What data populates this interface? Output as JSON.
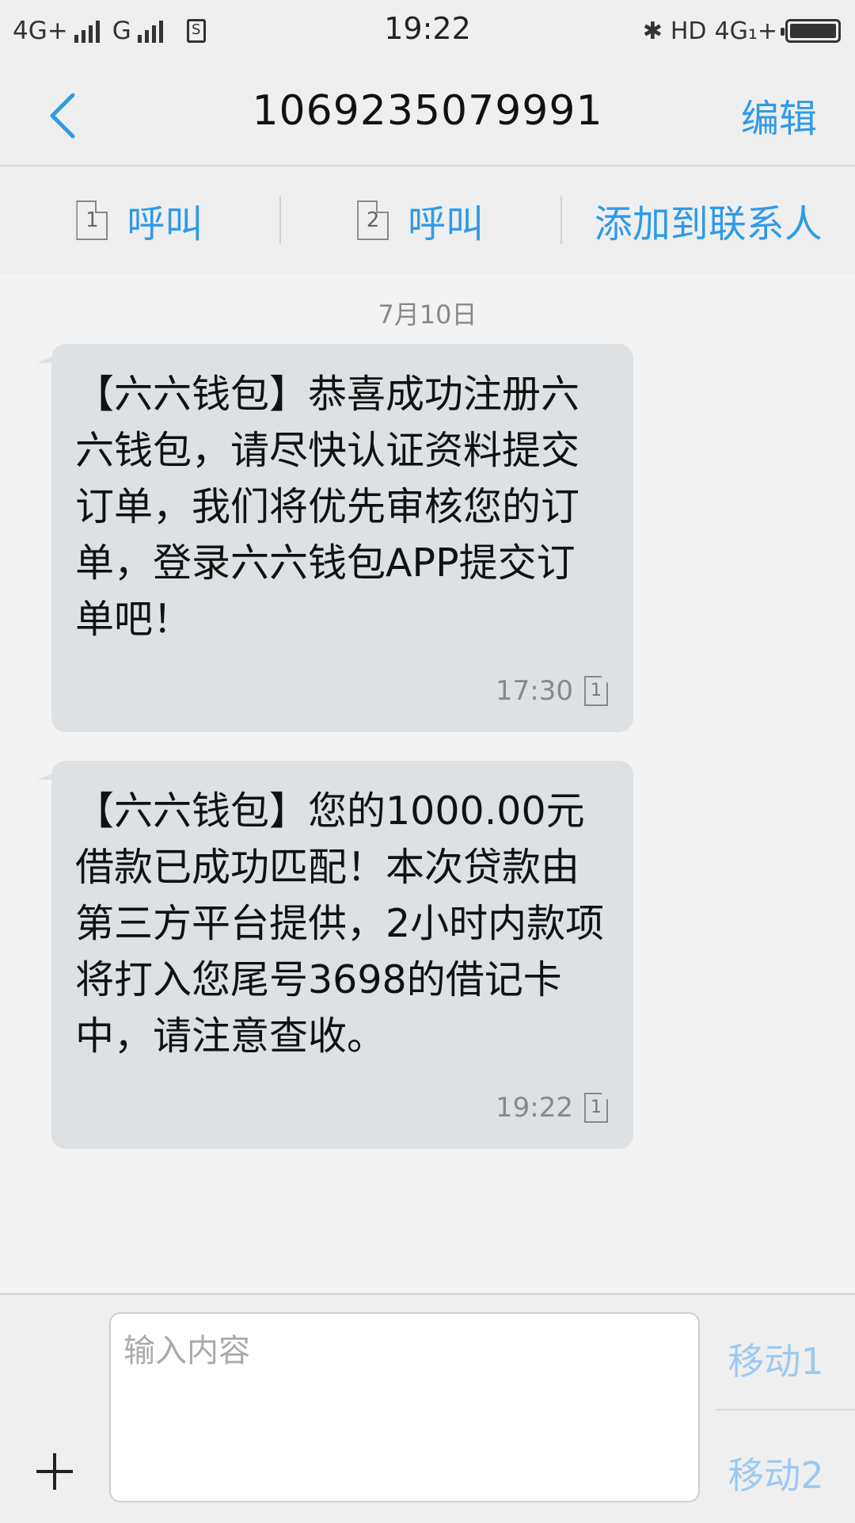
{
  "status_bar": {
    "network1": "4G+",
    "network2": "G",
    "sim_badge": "S",
    "time": "19:22",
    "hd": "HD",
    "network_right": "4G₁+"
  },
  "header": {
    "title": "1069235079991",
    "edit_label": "编辑"
  },
  "actions": {
    "call1_sim": "1",
    "call1_label": "呼叫",
    "call2_sim": "2",
    "call2_label": "呼叫",
    "add_contact_label": "添加到联系人"
  },
  "conversation": {
    "date": "7月10日",
    "messages": [
      {
        "text": "【六六钱包】恭喜成功注册六六钱包，请尽快认证资料提交订单，我们将优先审核您的订单，登录六六钱包APP提交订单吧！",
        "time": "17:30",
        "sim": "1"
      },
      {
        "text": "【六六钱包】您的1000.00元借款已成功匹配！本次贷款由第三方平台提供，2小时内款项将打入您尾号3698的借记卡中，请注意查收。",
        "time": "19:22",
        "sim": "1"
      }
    ]
  },
  "compose": {
    "placeholder": "输入内容",
    "send1_label": "移动1",
    "send2_label": "移动2"
  },
  "colors": {
    "accent": "#2f9ae8",
    "bubble": "#dde1e4",
    "send_disabled": "#9dc9ef"
  }
}
